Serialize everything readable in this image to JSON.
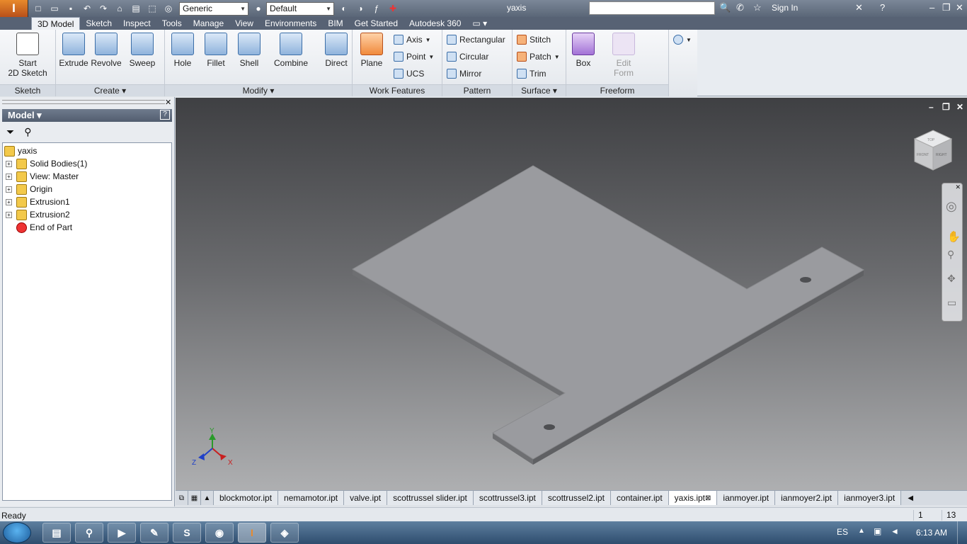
{
  "app": {
    "document_title": "yaxis",
    "app_button_label": "I",
    "material_select": "Generic",
    "appearance_select": "Default",
    "sign_in": "Sign In"
  },
  "ribbon_tabs": [
    "3D Model",
    "Sketch",
    "Inspect",
    "Tools",
    "Manage",
    "View",
    "Environments",
    "BIM",
    "Get Started",
    "Autodesk 360"
  ],
  "ribbon": {
    "sketch_group": {
      "title": "Sketch",
      "start_line1": "Start",
      "start_line2": "2D Sketch"
    },
    "create_group": {
      "title": "Create ▾",
      "extrude": "Extrude",
      "revolve": "Revolve",
      "sweep": "Sweep"
    },
    "modify_group": {
      "title": "Modify ▾",
      "hole": "Hole",
      "fillet": "Fillet",
      "shell": "Shell",
      "combine": "Combine",
      "direct": "Direct"
    },
    "work_features_group": {
      "title": "Work Features",
      "plane": "Plane",
      "axis": "Axis",
      "point": "Point",
      "ucs": "UCS"
    },
    "pattern_group": {
      "title": "Pattern",
      "rectangular": "Rectangular",
      "circular": "Circular",
      "mirror": "Mirror"
    },
    "surface_group": {
      "title": "Surface ▾",
      "stitch": "Stitch",
      "patch": "Patch",
      "trim": "Trim"
    },
    "freeform_group": {
      "title": "Freeform",
      "box": "Box",
      "edit_form_line1": "Edit",
      "edit_form_line2": "Form"
    }
  },
  "browser": {
    "header": "Model ▾",
    "tree": [
      {
        "label": "yaxis",
        "expandable": false,
        "indent": 0
      },
      {
        "label": "Solid Bodies(1)",
        "expandable": true,
        "indent": 1
      },
      {
        "label": "View: Master",
        "expandable": true,
        "indent": 1
      },
      {
        "label": "Origin",
        "expandable": true,
        "indent": 1
      },
      {
        "label": "Extrusion1",
        "expandable": true,
        "indent": 1
      },
      {
        "label": "Extrusion2",
        "expandable": true,
        "indent": 1
      },
      {
        "label": "End of Part",
        "expandable": false,
        "indent": 1
      }
    ]
  },
  "viewcube": {
    "face_front": "FRONT",
    "face_right": "RIGHT",
    "face_top": "TOP"
  },
  "axes": {
    "x": "X",
    "y": "Y",
    "z": "Z"
  },
  "document_tabs": [
    "blockmotor.ipt",
    "nemamotor.ipt",
    "valve.ipt",
    "scottrussel slider.ipt",
    "scottrussel3.ipt",
    "scottrussel2.ipt",
    "container.ipt",
    "yaxis.ipt",
    "ianmoyer.ipt",
    "ianmoyer2.ipt",
    "ianmoyer3.ipt"
  ],
  "active_document_tab": "yaxis.ipt",
  "status": {
    "text": "Ready",
    "value1": "1",
    "value2": "13"
  },
  "taskbar": {
    "language": "ES",
    "clock": "6:13 AM"
  },
  "colors": {
    "part_top": "#9a9b9f",
    "part_edge": "#6e6f72",
    "accent": "#e88a2c"
  }
}
